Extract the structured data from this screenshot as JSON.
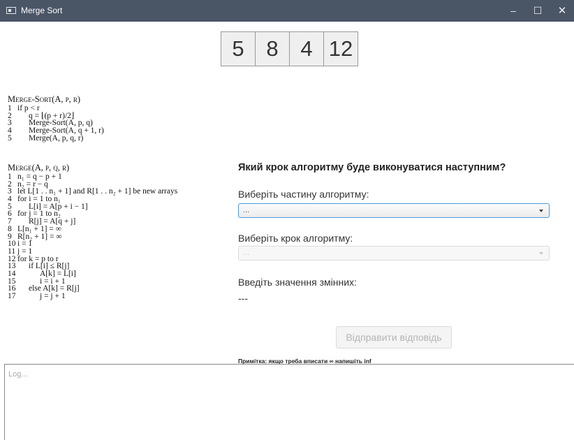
{
  "window": {
    "title": "Merge Sort",
    "minimize_glyph": "–",
    "maximize_glyph": "☐",
    "close_glyph": "✕"
  },
  "array": [
    "5",
    "8",
    "4",
    "12"
  ],
  "merge_sort": {
    "title": "Merge-Sort(A, p, r)",
    "lines": [
      {
        "n": "1",
        "text": "if p < r",
        "indent": 0
      },
      {
        "n": "2",
        "text": "q = ⌊(p + r)/2⌋",
        "indent": 1
      },
      {
        "n": "3",
        "text": "Merge-Sort(A, p, q)",
        "indent": 1
      },
      {
        "n": "4",
        "text": "Merge-Sort(A, q + 1, r)",
        "indent": 1
      },
      {
        "n": "5",
        "text": "Merge(A, p, q, r)",
        "indent": 1
      }
    ]
  },
  "merge": {
    "title": "Merge(A, p, q, r)",
    "lines": [
      {
        "n": "1",
        "text": "n₁ = q − p + 1",
        "indent": 0
      },
      {
        "n": "2",
        "text": "n₂ = r − q",
        "indent": 0
      },
      {
        "n": "3",
        "text": "let L[1 . . n₁ + 1] and R[1 . . n₂ + 1] be new arrays",
        "indent": 0
      },
      {
        "n": "4",
        "text": "for i = 1 to n₁",
        "indent": 0
      },
      {
        "n": "5",
        "text": "L[i] = A[p + i − 1]",
        "indent": 1
      },
      {
        "n": "6",
        "text": "for j = 1 to n₂",
        "indent": 0
      },
      {
        "n": "7",
        "text": "R[j] = A[q + j]",
        "indent": 1
      },
      {
        "n": "8",
        "text": "L[n₁ + 1] = ∞",
        "indent": 0
      },
      {
        "n": "9",
        "text": "R[n₂ + 1] = ∞",
        "indent": 0
      },
      {
        "n": "10",
        "text": "i = 1",
        "indent": 0
      },
      {
        "n": "11",
        "text": "j = 1",
        "indent": 0
      },
      {
        "n": "12",
        "text": "for k = p to r",
        "indent": 0
      },
      {
        "n": "13",
        "text": "if L[i] ≤ R[j]",
        "indent": 1
      },
      {
        "n": "14",
        "text": "A[k] = L[i]",
        "indent": 2
      },
      {
        "n": "15",
        "text": "i = i + 1",
        "indent": 2
      },
      {
        "n": "16",
        "text": "else A[k] = R[j]",
        "indent": 1
      },
      {
        "n": "17",
        "text": "j = j + 1",
        "indent": 2
      }
    ]
  },
  "form": {
    "question": "Який крок алгоритму буде виконуватися наступним?",
    "part_label": "Виберіть частину алгоритму:",
    "part_value": "...",
    "step_label": "Виберіть крок алгоритму:",
    "step_value": "...",
    "vars_label": "Введіть значення змінних:",
    "vars_value": "---",
    "submit_label": "Відправити відповідь",
    "note": "Примітка: якщо треба вписати ∞  напишіть inf"
  },
  "log": {
    "placeholder": "Log..."
  }
}
